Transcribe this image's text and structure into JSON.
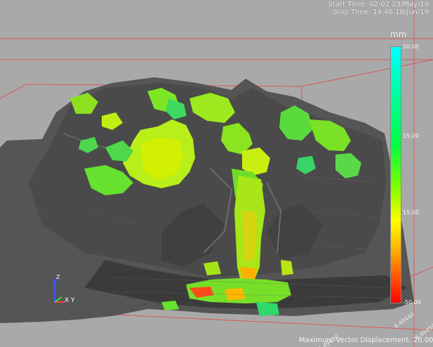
{
  "header": {
    "start_time": "Start Time: 02:02 23/May/19",
    "stop_time": "Stop Time: 14:46 18/Jun/19"
  },
  "colorbar": {
    "unit": "mm",
    "ticks": [
      "50.00",
      "15.00",
      "15.00",
      "-50.00"
    ],
    "colors": [
      "#00ffff",
      "#00ff66",
      "#80ff00",
      "#ffff00",
      "#ff8800",
      "#ff0000"
    ]
  },
  "footer": {
    "max_vector": "Maximum Vector Displacement: 20.00 mm",
    "coords": [
      "6.49450",
      "6.49440",
      "6.49430"
    ]
  },
  "triad": {
    "z_label": "Z",
    "xy_label": "X Y"
  },
  "scene": {
    "background": "#a9a9a9",
    "rock_color": "#5a5a5a",
    "bounding_box_color": "#e04040",
    "displacement_colors": [
      "#66ff33",
      "#c8ff00",
      "#2fd86b",
      "#ffde00",
      "#ff4a1a"
    ]
  }
}
